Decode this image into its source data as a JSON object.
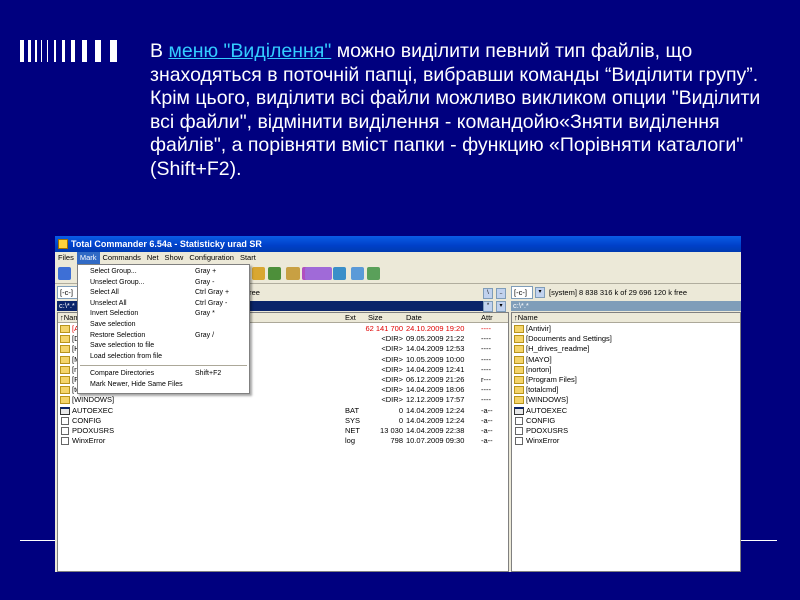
{
  "slide": {
    "paragraph": {
      "before": "В ",
      "link": "меню \"Виділення\"",
      "after": "  можно виділити певний  тип файлів, що знаходяться в поточній папці, вибравши  команды “Виділити групу”. Крім цього, виділити всі файли можливо викликом опции \"Виділити всі файли\", відмінити виділення - командойю«Зняти виділення файлів\", а порівняти вміст папки - функцию «Порівняти каталоги\" (Shift+F2)."
    },
    "colors": {
      "background": "#00007f",
      "text": "#ffffff",
      "link": "#33ccff"
    }
  },
  "window": {
    "title": "Total Commander 6.54a - Statisticky urad SR",
    "menu": [
      "Files",
      "Mark",
      "Commands",
      "Net",
      "Show",
      "Configuration",
      "Start"
    ],
    "active_menu": "Mark",
    "mark_menu": {
      "group1": [
        {
          "label": "Select Group...",
          "shortcut": "Gray +"
        },
        {
          "label": "Unselect Group...",
          "shortcut": "Gray -"
        },
        {
          "label": "Select All",
          "shortcut": "Ctrl Gray +"
        },
        {
          "label": "Unselect All",
          "shortcut": "Ctrl Gray -"
        },
        {
          "label": "Invert Selection",
          "shortcut": "Gray *"
        },
        {
          "label": "Save selection",
          "shortcut": ""
        },
        {
          "label": "Restore Selection",
          "shortcut": "Gray /"
        },
        {
          "label": "Save selection to file",
          "shortcut": ""
        },
        {
          "label": "Load selection from file",
          "shortcut": ""
        }
      ],
      "group2": [
        {
          "label": "Compare Directories",
          "shortcut": "Shift+F2"
        },
        {
          "label": "Mark Newer, Hide Same Files",
          "shortcut": ""
        }
      ]
    },
    "left_panel": {
      "drive": "[-c-]",
      "free_text": "free",
      "path": "c:\\*.*",
      "columns": {
        "name": "↑Name",
        "ext": "Ext",
        "size": "Size",
        "date": "Date",
        "attr": "Attr"
      },
      "rows": [
        {
          "name": "[A",
          "ext": "",
          "size": "62 141 700",
          "date": "24.10.2009 19:20",
          "attr": "----",
          "type": "folder",
          "highlight": true
        },
        {
          "name": "[D",
          "ext": "",
          "size": "<DIR>",
          "date": "09.05.2009 21:22",
          "attr": "----",
          "type": "folder"
        },
        {
          "name": "[H",
          "ext": "",
          "size": "<DIR>",
          "date": "14.04.2009 12:53",
          "attr": "----",
          "type": "folder"
        },
        {
          "name": "[M",
          "ext": "",
          "size": "<DIR>",
          "date": "10.05.2009 10:00",
          "attr": "----",
          "type": "folder"
        },
        {
          "name": "[n",
          "ext": "",
          "size": "<DIR>",
          "date": "14.04.2009 12:41",
          "attr": "----",
          "type": "folder"
        },
        {
          "name": "[P",
          "ext": "",
          "size": "<DIR>",
          "date": "06.12.2009 21:26",
          "attr": "r---",
          "type": "folder"
        },
        {
          "name": "[to",
          "ext": "",
          "size": "<DIR>",
          "date": "14.04.2009 18:06",
          "attr": "----",
          "type": "folder"
        },
        {
          "name": "[WINDOWS]",
          "ext": "",
          "size": "<DIR>",
          "date": "12.12.2009 17:57",
          "attr": "----",
          "type": "folder"
        },
        {
          "name": "AUTOEXEC",
          "ext": "BAT",
          "size": "0",
          "date": "14.04.2009 12:24",
          "attr": "-a--",
          "type": "exe"
        },
        {
          "name": "CONFIG",
          "ext": "SYS",
          "size": "0",
          "date": "14.04.2009 12:24",
          "attr": "-a--",
          "type": "file"
        },
        {
          "name": "PDOXUSRS",
          "ext": "NET",
          "size": "13 030",
          "date": "14.04.2009 22:38",
          "attr": "-a--",
          "type": "file"
        },
        {
          "name": "WinxError",
          "ext": "log",
          "size": "798",
          "date": "10.07.2009 09:30",
          "attr": "-a--",
          "type": "file"
        }
      ]
    },
    "right_panel": {
      "drive": "[-c-]",
      "drive_info": "[system]  8 838 316 k of 29 696 120 k free",
      "path": "c:\\*.*",
      "columns": {
        "name": "↑Name"
      },
      "rows": [
        {
          "name": "[Antivir]",
          "type": "folder"
        },
        {
          "name": "[Documents and Settings]",
          "type": "folder"
        },
        {
          "name": "[H_drives_readme]",
          "type": "folder"
        },
        {
          "name": "[MAYO]",
          "type": "folder"
        },
        {
          "name": "[norton]",
          "type": "folder"
        },
        {
          "name": "[Program Files]",
          "type": "folder"
        },
        {
          "name": "[totalcmd]",
          "type": "folder"
        },
        {
          "name": "[WINDOWS]",
          "type": "folder"
        },
        {
          "name": "AUTOEXEC",
          "type": "exe"
        },
        {
          "name": "CONFIG",
          "type": "file"
        },
        {
          "name": "PDOXUSRS",
          "type": "file"
        },
        {
          "name": "WinxError",
          "type": "file"
        }
      ]
    }
  }
}
